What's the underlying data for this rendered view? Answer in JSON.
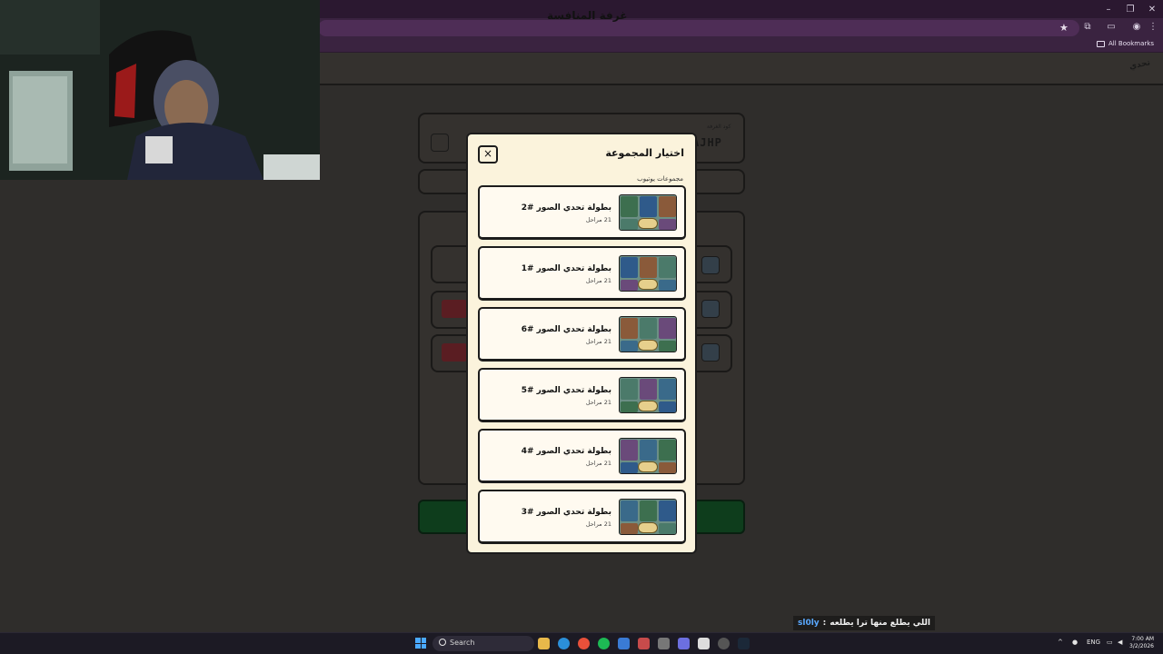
{
  "browser": {
    "bookmarks_label": "All Bookmarks",
    "window_controls": [
      "minimize-icon",
      "restore-icon",
      "close-icon"
    ]
  },
  "page": {
    "title": "غرفة المنافسة",
    "room_code": "AJHP",
    "room_code_label": "كود الغرفة"
  },
  "modal": {
    "title": "اختيار المجموعة",
    "close_label": "×",
    "section_label": "مجموعات يوتيوب",
    "groups": [
      {
        "name": "بطولة تحدي الصور #2",
        "count": "21 مراحل"
      },
      {
        "name": "بطولة تحدي الصور #1",
        "count": "21 مراحل"
      },
      {
        "name": "بطولة تحدي الصور #6",
        "count": "21 مراحل"
      },
      {
        "name": "بطولة تحدي الصور #5",
        "count": "21 مراحل"
      },
      {
        "name": "بطولة تحدي الصور #4",
        "count": "21 مراحل"
      },
      {
        "name": "بطولة تحدي الصور #3",
        "count": "21 مراحل"
      }
    ]
  },
  "chat": {
    "user": "sl0ly",
    "separator": ":",
    "message": "اللي يطلع منها ترا يطلعه"
  },
  "taskbar": {
    "search_placeholder": "Search",
    "language": "ENG",
    "time": "7:00 AM",
    "date": "3/2/2026"
  },
  "colors": {
    "modal_bg": "#fbf3dc",
    "chat_user": "#5aa9ff",
    "browser_chrome": "#3a2340"
  }
}
